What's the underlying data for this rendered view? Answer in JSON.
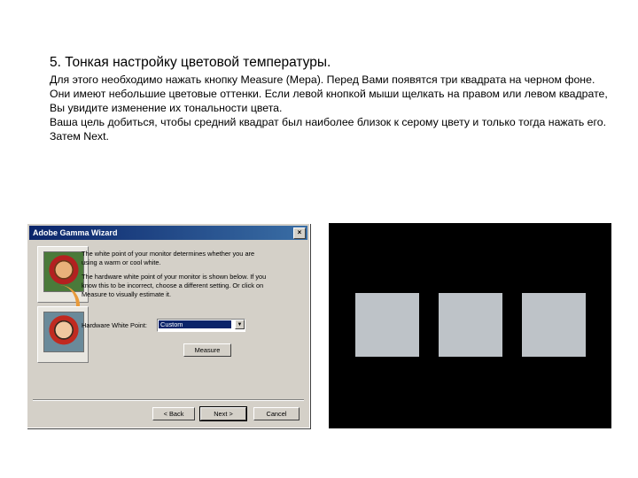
{
  "slide": {
    "title": "5. Тонкая настройку цветовой температуры.",
    "paragraph1": "Для этого необходимо нажать кнопку Measure (Мера). Перед Вами появятся три квадрата на черном фоне. Они имеют небольшие цветовые оттенки. Если левой кнопкой мыши щелкать на правом или левом квадрате, Вы увидите изменение их тональности цвета.",
    "paragraph2": "Ваша цель добиться, чтобы средний квадрат был наиболее близок к серому цвету и только тогда нажать его. Затем Next."
  },
  "dialog": {
    "title": "Adobe Gamma Wizard",
    "close_label": "×",
    "text1": "The white point of your monitor determines whether you are using a warm or cool white.",
    "text2": "The hardware white point of your monitor is shown below. If you know this to be incorrect, choose a different setting. Or click on Measure to visually estimate it.",
    "hw_label": "Hardware White Point:",
    "hw_value": "Custom",
    "hw_arrow": "▼",
    "measure_label": "Measure",
    "back_label": "< Back",
    "next_label": "Next >",
    "cancel_label": "Cancel"
  },
  "icons": {
    "warm_monitor": "monitor-warm-icon",
    "cool_monitor": "monitor-cool-icon",
    "arrow": "curved-arrow-icon"
  },
  "colors": {
    "swatch": "#bec3c8",
    "panel": "#000000",
    "titlebar": "#0a246a"
  }
}
